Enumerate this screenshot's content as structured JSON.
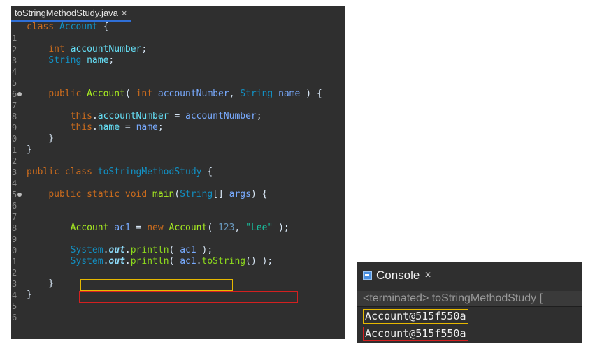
{
  "editor": {
    "tab_label": "toStringMethodStudy.java",
    "tab_close": "×",
    "line_numbers": [
      "1",
      "2",
      "3",
      "4",
      "5",
      "6",
      "7",
      "8",
      "9",
      "0",
      "1",
      "2",
      "3",
      "4",
      "5",
      "6",
      "7",
      "8",
      "9",
      "0",
      "1",
      "2",
      "3",
      "4",
      "5",
      "6"
    ],
    "lines": [
      "class Account {",
      "",
      "    int accountNumber;",
      "    String name;",
      "",
      "",
      "    public Account( int accountNumber, String name ) {",
      "",
      "        this.accountNumber = accountNumber;",
      "        this.name = name;",
      "    }",
      "}",
      "",
      "public class toStringMethodStudy {",
      "",
      "    public static void main(String[] args) {",
      "",
      "",
      "        Account ac1 = new Account( 123, \"Lee\" );",
      "",
      "        System.out.println( ac1 );",
      "        System.out.println( ac1.toString() );",
      "",
      "    }",
      "}",
      ""
    ]
  },
  "console": {
    "tab_label": "Console",
    "tab_close": "×",
    "status": "<terminated> toStringMethodStudy [",
    "output_lines": [
      "Account@515f550a",
      "Account@515f550a"
    ]
  },
  "colors": {
    "editor_bg": "#2f2f2f",
    "highlight_yellow": "#e6b800",
    "highlight_red": "#d42020"
  }
}
